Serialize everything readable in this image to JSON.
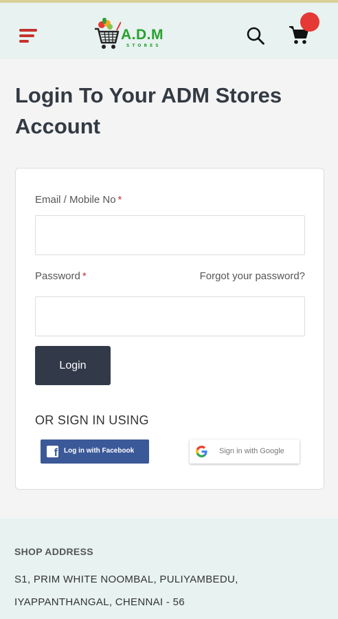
{
  "header": {
    "logo_text": "A.D.M",
    "logo_subtext": "STORES",
    "menu_icon": "hamburger-menu-icon",
    "search_icon": "search-icon",
    "cart_icon": "cart-icon",
    "accent_color": "#c7322c",
    "brand_color": "#27a12d"
  },
  "main": {
    "title": "Login To Your ADM Stores Account"
  },
  "form": {
    "email_label": "Email / Mobile No",
    "password_label": "Password",
    "required_mark": "*",
    "forgot_password": "Forgot your password?",
    "email_value": "",
    "password_value": "",
    "login_label": "Login",
    "login_color": "#323a4a",
    "or_sign_in": "OR SIGN IN USING",
    "facebook_label": "Log in with Facebook",
    "facebook_color": "#3b5998",
    "google_label": "Sign in with Google"
  },
  "footer": {
    "title": "SHOP ADDRESS",
    "address_line1": "S1, PRIM WHITE NOOMBAL, PULIYAMBEDU,",
    "address_line2": "IYAPPANTHANGAL, CHENNAI - 56"
  }
}
